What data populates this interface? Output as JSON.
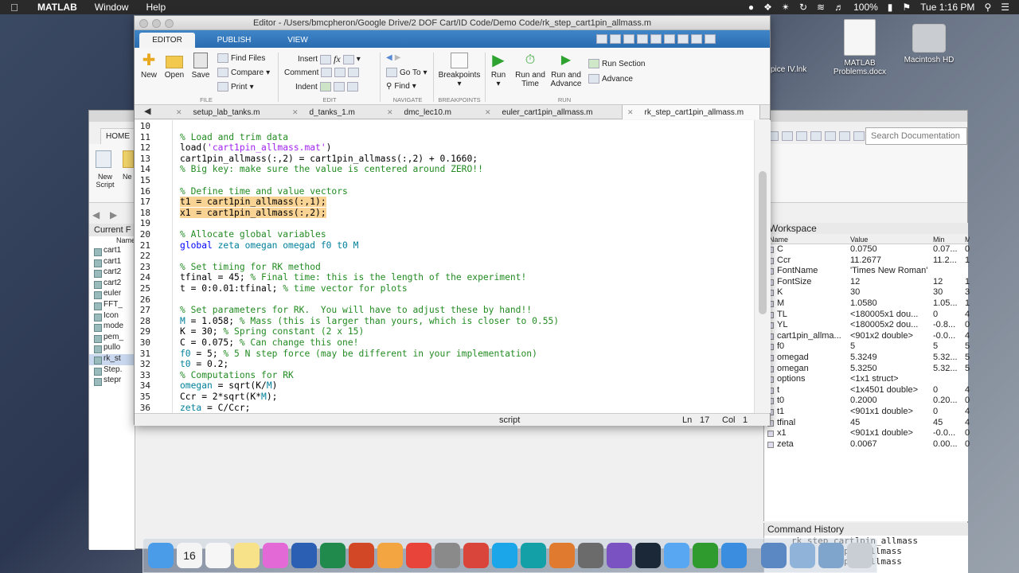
{
  "menubar": {
    "app_name": "MATLAB",
    "items": [
      "Window",
      "Help"
    ],
    "battery": "100%",
    "clock": "Tue 1:16 PM"
  },
  "desktop": {
    "icons": [
      {
        "label": "MATLAB Problems.docx"
      },
      {
        "label": "Macintosh HD"
      }
    ],
    "partial_label": "pice IV.lnk"
  },
  "editor": {
    "title": "Editor - /Users/bmcpheron/Google Drive/2 DOF Cart/ID Code/Demo Code/rk_step_cart1pin_allmass.m",
    "ribbon_tabs": [
      "EDITOR",
      "PUBLISH",
      "VIEW"
    ],
    "file_buttons": {
      "new": "New",
      "open": "Open",
      "save": "Save",
      "find_files": "Find Files",
      "compare": "Compare",
      "print": "Print"
    },
    "edit_buttons": {
      "insert": "Insert",
      "comment": "Comment",
      "indent": "Indent",
      "fx": "fx"
    },
    "navigate_buttons": {
      "goto": "Go To",
      "find": "Find"
    },
    "breakpoints_button": "Breakpoints",
    "run_buttons": {
      "run": "Run",
      "run_time": "Run and Time",
      "run_advance": "Run and Advance",
      "run_section": "Run Section",
      "advance": "Advance"
    },
    "section_labels": {
      "file": "FILE",
      "edit": "EDIT",
      "navigate": "NAVIGATE",
      "breakpoints": "BREAKPOINTS",
      "run": "RUN"
    },
    "file_tabs": [
      "setup_lab_tanks.m",
      "d_tanks_1.m",
      "dmc_lec10.m",
      "euler_cart1pin_allmass.m",
      "rk_step_cart1pin_allmass.m"
    ],
    "active_tab": "rk_step_cart1pin_allmass.m",
    "code_lines": [
      {
        "n": "10",
        "segs": []
      },
      {
        "n": "11",
        "segs": [
          {
            "t": "% Load and trim data",
            "c": "cm"
          }
        ]
      },
      {
        "n": "12",
        "segs": [
          {
            "t": "load(",
            "c": ""
          },
          {
            "t": "'cart1pin_allmass.mat'",
            "c": "str"
          },
          {
            "t": ")",
            "c": ""
          }
        ]
      },
      {
        "n": "13",
        "segs": [
          {
            "t": "cart1pin_allmass(:,2) = cart1pin_allmass(:,2) + 0.1660;",
            "c": ""
          }
        ]
      },
      {
        "n": "14",
        "segs": [
          {
            "t": "% Big key: make sure the value is centered around ZERO!!",
            "c": "cm"
          }
        ]
      },
      {
        "n": "15",
        "segs": []
      },
      {
        "n": "16",
        "segs": [
          {
            "t": "% Define time and value vectors",
            "c": "cm"
          }
        ]
      },
      {
        "n": "17",
        "segs": [
          {
            "t": "t1 = cart1pin_allmass(:,1);",
            "c": "hl"
          }
        ]
      },
      {
        "n": "18",
        "segs": [
          {
            "t": "x1 = cart1pin_allmass(:,2);",
            "c": "hl"
          }
        ]
      },
      {
        "n": "19",
        "segs": []
      },
      {
        "n": "20",
        "segs": [
          {
            "t": "% Allocate global variables",
            "c": "cm"
          }
        ]
      },
      {
        "n": "21",
        "segs": [
          {
            "t": "global",
            "c": "kw"
          },
          {
            "t": " zeta omegan omegad f0 t0 M",
            "c": "var"
          }
        ]
      },
      {
        "n": "22",
        "segs": []
      },
      {
        "n": "23",
        "segs": [
          {
            "t": "% Set timing for RK method",
            "c": "cm"
          }
        ]
      },
      {
        "n": "24",
        "segs": [
          {
            "t": "tfinal = 45; ",
            "c": ""
          },
          {
            "t": "% Final time: this is the length of the experiment!",
            "c": "cm"
          }
        ]
      },
      {
        "n": "25",
        "segs": [
          {
            "t": "t = 0:0.01:tfinal; ",
            "c": ""
          },
          {
            "t": "% time vector for plots",
            "c": "cm"
          }
        ]
      },
      {
        "n": "26",
        "segs": []
      },
      {
        "n": "27",
        "segs": [
          {
            "t": "% Set parameters for RK.  You will have to adjust these by hand!!",
            "c": "cm"
          }
        ]
      },
      {
        "n": "28",
        "segs": [
          {
            "t": "M",
            "c": "var"
          },
          {
            "t": " = 1.058; ",
            "c": ""
          },
          {
            "t": "% Mass (this is larger than yours, which is closer to 0.55)",
            "c": "cm"
          }
        ]
      },
      {
        "n": "29",
        "segs": [
          {
            "t": "K = 30; ",
            "c": ""
          },
          {
            "t": "% Spring constant (2 x 15)",
            "c": "cm"
          }
        ]
      },
      {
        "n": "30",
        "segs": [
          {
            "t": "C = 0.075; ",
            "c": ""
          },
          {
            "t": "% Can change this one!",
            "c": "cm"
          }
        ]
      },
      {
        "n": "31",
        "segs": [
          {
            "t": "f0",
            "c": "var"
          },
          {
            "t": " = 5; ",
            "c": ""
          },
          {
            "t": "% 5 N step force (may be different in your implementation)",
            "c": "cm"
          }
        ]
      },
      {
        "n": "32",
        "segs": [
          {
            "t": "t0",
            "c": "var"
          },
          {
            "t": " = 0.2;",
            "c": ""
          }
        ]
      },
      {
        "n": "33",
        "segs": [
          {
            "t": "% Computations for RK",
            "c": "cm"
          }
        ]
      },
      {
        "n": "34",
        "segs": [
          {
            "t": "omegan",
            "c": "var"
          },
          {
            "t": " = sqrt(K/",
            "c": ""
          },
          {
            "t": "M",
            "c": "var"
          },
          {
            "t": ")",
            "c": ""
          }
        ]
      },
      {
        "n": "35",
        "segs": [
          {
            "t": "Ccr = 2*sqrt(K*",
            "c": ""
          },
          {
            "t": "M",
            "c": "var"
          },
          {
            "t": ");",
            "c": ""
          }
        ]
      },
      {
        "n": "36",
        "segs": [
          {
            "t": "zeta",
            "c": "var"
          },
          {
            "t": " = C/Ccr;",
            "c": ""
          }
        ]
      }
    ],
    "status": {
      "mode": "script",
      "ln_label": "Ln",
      "ln": "17",
      "col_label": "Col",
      "col": "1"
    }
  },
  "mainwindow": {
    "home_tab": "HOME",
    "new_script": "New Script",
    "new_partial": "Ne",
    "current_folder_label": "Current F",
    "name_col": "Name",
    "folder_items": [
      "cart1",
      "cart1",
      "cart2",
      "cart2",
      "euler",
      "FFT_",
      "Icon",
      "mode",
      "pem_",
      "pullo",
      "rk_st",
      "Step.",
      "stepr"
    ],
    "selected_folder_item": 10,
    "search_placeholder": "Search Documentation"
  },
  "workspace": {
    "title": "Workspace",
    "columns": [
      "Name",
      "Value",
      "Min",
      "M"
    ],
    "rows": [
      {
        "name": "C",
        "value": "0.0750",
        "min": "0.07...",
        "max": "0"
      },
      {
        "name": "Ccr",
        "value": "11.2677",
        "min": "11.2...",
        "max": "1"
      },
      {
        "name": "FontName",
        "value": "'Times New Roman'",
        "min": "",
        "max": ""
      },
      {
        "name": "FontSize",
        "value": "12",
        "min": "12",
        "max": "1"
      },
      {
        "name": "K",
        "value": "30",
        "min": "30",
        "max": "3"
      },
      {
        "name": "M",
        "value": "1.0580",
        "min": "1.05...",
        "max": "1"
      },
      {
        "name": "TL",
        "value": "<180005x1 dou...",
        "min": "0",
        "max": "4"
      },
      {
        "name": "YL",
        "value": "<180005x2 dou...",
        "min": "-0.8...",
        "max": "0"
      },
      {
        "name": "cart1pin_allma...",
        "value": "<901x2 double>",
        "min": "-0.0...",
        "max": "4"
      },
      {
        "name": "f0",
        "value": "5",
        "min": "5",
        "max": "5"
      },
      {
        "name": "omegad",
        "value": "5.3249",
        "min": "5.32...",
        "max": "5"
      },
      {
        "name": "omegan",
        "value": "5.3250",
        "min": "5.32...",
        "max": "5"
      },
      {
        "name": "options",
        "value": "<1x1 struct>",
        "min": "",
        "max": ""
      },
      {
        "name": "t",
        "value": "<1x4501 double>",
        "min": "0",
        "max": "4"
      },
      {
        "name": "t0",
        "value": "0.2000",
        "min": "0.20...",
        "max": "0"
      },
      {
        "name": "t1",
        "value": "<901x1 double>",
        "min": "0",
        "max": "4"
      },
      {
        "name": "tfinal",
        "value": "45",
        "min": "45",
        "max": "4"
      },
      {
        "name": "x1",
        "value": "<901x1 double>",
        "min": "-0.0...",
        "max": "0"
      },
      {
        "name": "zeta",
        "value": "0.0067",
        "min": "0.00...",
        "max": "0"
      }
    ]
  },
  "command_history": {
    "title": "Command History",
    "lines": [
      "rk_step_cart1pin_allmass",
      "pin_allmass",
      "pin_allmass"
    ]
  },
  "dock": {
    "calendar_day": "16",
    "apps": [
      "finder",
      "calendar",
      "reminders",
      "notes",
      "itunes",
      "word",
      "excel",
      "powerpoint",
      "outlook",
      "chrome",
      "system-preferences",
      "parallels",
      "skype",
      "arduino",
      "matlab",
      "calculator",
      "visual-studio",
      "steam",
      "messages",
      "quicktime",
      "xcode",
      "folder-1",
      "downloads",
      "folder-2",
      "trash"
    ]
  }
}
